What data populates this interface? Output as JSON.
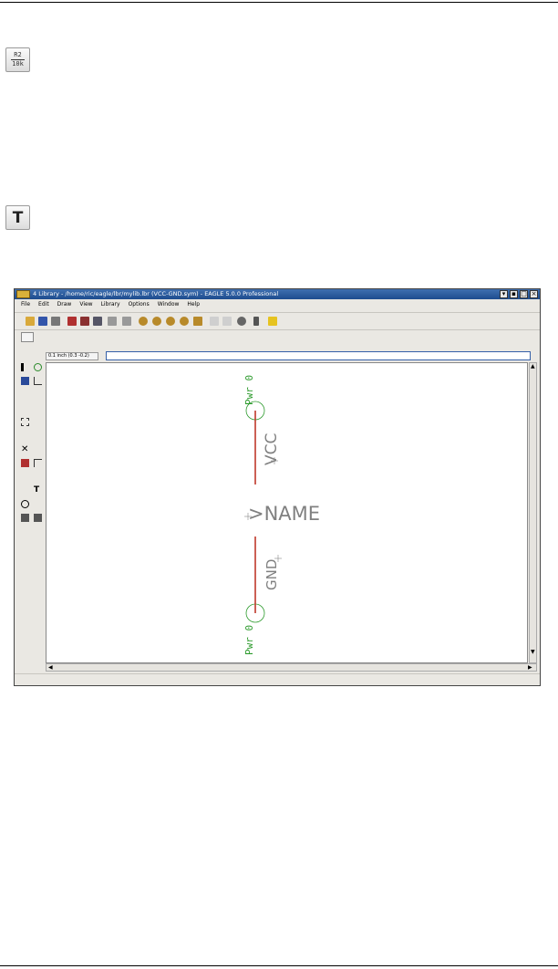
{
  "icons": {
    "value_icon": {
      "top_text": "R2",
      "bottom_text": "10k"
    },
    "text_icon": {
      "glyph": "T"
    }
  },
  "window": {
    "title": "4 Library - /home/ric/eagle/lbr/mylib.lbr (VCC-GND.sym) - EAGLE 5.0.0 Professional",
    "menu": [
      "File",
      "Edit",
      "Draw",
      "View",
      "Library",
      "Options",
      "Window",
      "Help"
    ],
    "coordinates": "0.1 inch (0.3 -0.2)",
    "command": ""
  },
  "symbol": {
    "top_pin_label": "Pwr 0",
    "bottom_pin_label": "Pwr 0",
    "vcc_label": "VCC",
    "gnd_label": "GND",
    "name_label": ">NAME"
  },
  "colors": {
    "pin_green": "#2c9a2c",
    "wire_red": "#c0392b",
    "label_gray": "#808080",
    "titlebar_blue": "#1d4c8e"
  }
}
